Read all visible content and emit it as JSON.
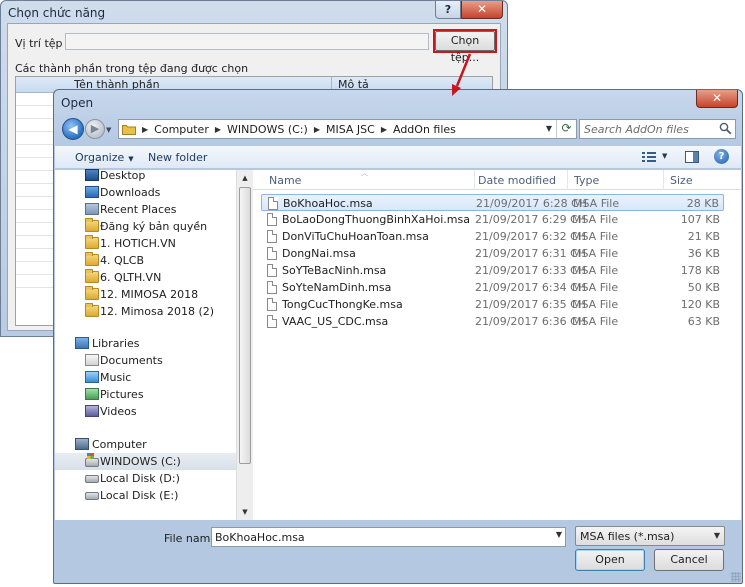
{
  "background_dialog": {
    "title": "Chọn chức năng",
    "help_label": "?",
    "close_label": "✕",
    "location_label": "Vị trí tệp",
    "path_value": "",
    "choose_button_label": "Chọn tệp...",
    "components_label": "Các thành phần trong tệp đang được chọn",
    "grid_headers": [
      "Tên thành phần",
      "Mô tả"
    ]
  },
  "open_dialog": {
    "title": "Open",
    "close_label": "✕",
    "address": {
      "segments": [
        "Computer",
        "WINDOWS (C:)",
        "MISA JSC",
        "AddOn files"
      ]
    },
    "search": {
      "placeholder": "Search AddOn files"
    },
    "toolbar": {
      "organize_label": "Organize",
      "new_folder_label": "New folder"
    },
    "nav": {
      "favorites": [
        {
          "label": "Desktop",
          "icon": "desktop-icon"
        },
        {
          "label": "Downloads",
          "icon": "downloads-icon"
        },
        {
          "label": "Recent Places",
          "icon": "recent-places-icon"
        },
        {
          "label": "Đăng ký bản quyền",
          "icon": "folder-icon"
        },
        {
          "label": "1. HOTICH.VN",
          "icon": "folder-icon"
        },
        {
          "label": "4. QLCB",
          "icon": "folder-icon"
        },
        {
          "label": "6. QLTH.VN",
          "icon": "folder-icon"
        },
        {
          "label": "12. MIMOSA 2018",
          "icon": "folder-icon"
        },
        {
          "label": "12. Mimosa 2018 (2)",
          "icon": "folder-icon"
        }
      ],
      "libraries_label": "Libraries",
      "libraries": [
        {
          "label": "Documents",
          "icon": "documents-icon"
        },
        {
          "label": "Music",
          "icon": "music-icon"
        },
        {
          "label": "Pictures",
          "icon": "pictures-icon"
        },
        {
          "label": "Videos",
          "icon": "videos-icon"
        }
      ],
      "computer_label": "Computer",
      "drives": [
        {
          "label": "WINDOWS (C:)",
          "icon": "system-drive-icon",
          "selected": true
        },
        {
          "label": "Local Disk (D:)",
          "icon": "disk-icon",
          "selected": false
        },
        {
          "label": "Local Disk (E:)",
          "icon": "disk-icon",
          "selected": false
        }
      ]
    },
    "columns": {
      "name": "Name",
      "date": "Date modified",
      "type": "Type",
      "size": "Size"
    },
    "files": [
      {
        "name": "BoKhoaHoc.msa",
        "date": "21/09/2017 6:28 CH",
        "type": "MSA File",
        "size": "28 KB",
        "selected": true
      },
      {
        "name": "BoLaoDongThuongBinhXaHoi.msa",
        "date": "21/09/2017 6:29 CH",
        "type": "MSA File",
        "size": "107 KB",
        "selected": false
      },
      {
        "name": "DonViTuChuHoanToan.msa",
        "date": "21/09/2017 6:32 CH",
        "type": "MSA File",
        "size": "21 KB",
        "selected": false
      },
      {
        "name": "DongNai.msa",
        "date": "21/09/2017 6:31 CH",
        "type": "MSA File",
        "size": "36 KB",
        "selected": false
      },
      {
        "name": "SoYTeBacNinh.msa",
        "date": "21/09/2017 6:33 CH",
        "type": "MSA File",
        "size": "178 KB",
        "selected": false
      },
      {
        "name": "SoYteNamDinh.msa",
        "date": "21/09/2017 6:34 CH",
        "type": "MSA File",
        "size": "50 KB",
        "selected": false
      },
      {
        "name": "TongCucThongKe.msa",
        "date": "21/09/2017 6:35 CH",
        "type": "MSA File",
        "size": "120 KB",
        "selected": false
      },
      {
        "name": "VAAC_US_CDC.msa",
        "date": "21/09/2017 6:36 CH",
        "type": "MSA File",
        "size": "63 KB",
        "selected": false
      }
    ],
    "file_name_label": "File name:",
    "file_name_value": "BoKhoaHoc.msa",
    "file_type_value": "MSA files (*.msa)",
    "open_label": "Open",
    "cancel_label": "Cancel"
  },
  "colors": {
    "highlight_red": "#c41a1f",
    "selection_blue": "#d7e7fa",
    "chrome_blue": "#b4c8e2"
  }
}
